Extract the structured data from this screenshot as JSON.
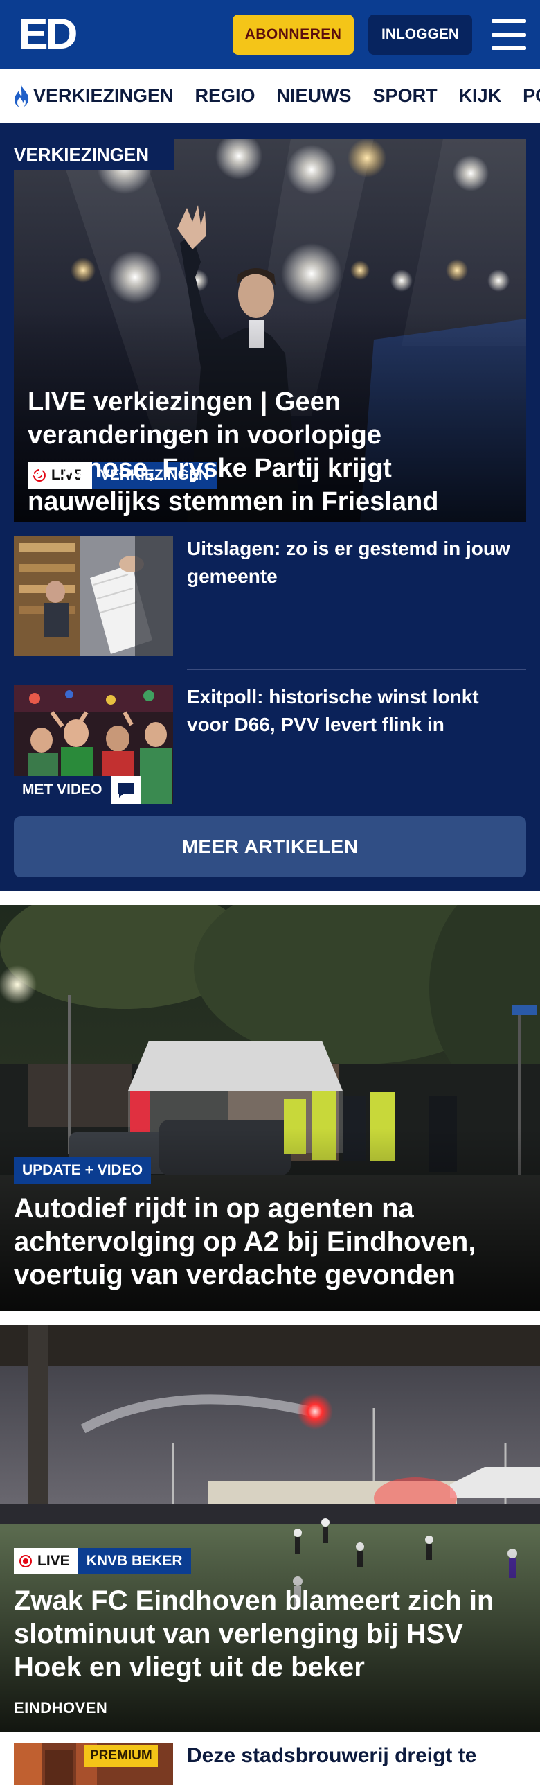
{
  "header": {
    "logo": "ED",
    "subscribe_label": "ABONNEREN",
    "login_label": "INLOGGEN",
    "menu_icon": "hamburger-menu-icon"
  },
  "nav": {
    "items": [
      "VERKIEZINGEN",
      "REGIO",
      "NIEUWS",
      "SPORT",
      "KIJK",
      "PODC"
    ],
    "first_item_icon": "flame-icon"
  },
  "election": {
    "section_label": "VERKIEZINGEN",
    "hero": {
      "live_label": "LIVE",
      "category": "VERKIEZINGEN",
      "title": "LIVE verkiezingen | Geen veranderingen in voorlopige prognose, Fryske Partij krijgt nauwelijks stemmen in Friesland"
    },
    "articles": [
      {
        "title": "Uitslagen: zo is er gestemd in jouw gemeente"
      },
      {
        "title": "Exitpoll: historische winst lonkt voor D66, PVV levert flink in",
        "badge": "MET VIDEO",
        "badge_icon": "chat-icon"
      }
    ],
    "more_label": "MEER ARTIKELEN"
  },
  "cards": [
    {
      "badge": "UPDATE + VIDEO",
      "title": "Autodief rijdt in op agenten na achtervolging op A2 bij Eindhoven, voertuig van verdachte gevonden"
    },
    {
      "live_label": "LIVE",
      "badge": "KNVB BEKER",
      "title": "Zwak FC Eindhoven blameert zich in slotminuut van verlenging bij HSV Hoek en vliegt uit de beker",
      "location": "EINDHOVEN"
    }
  ],
  "last_item": {
    "badge": "PREMIUM",
    "title": "Deze stadsbrouwerij dreigt te"
  },
  "colors": {
    "header_blue": "#0b3d91",
    "section_navy": "#0b2259",
    "subscribe_yellow": "#f4c518",
    "live_red": "#e30613"
  }
}
